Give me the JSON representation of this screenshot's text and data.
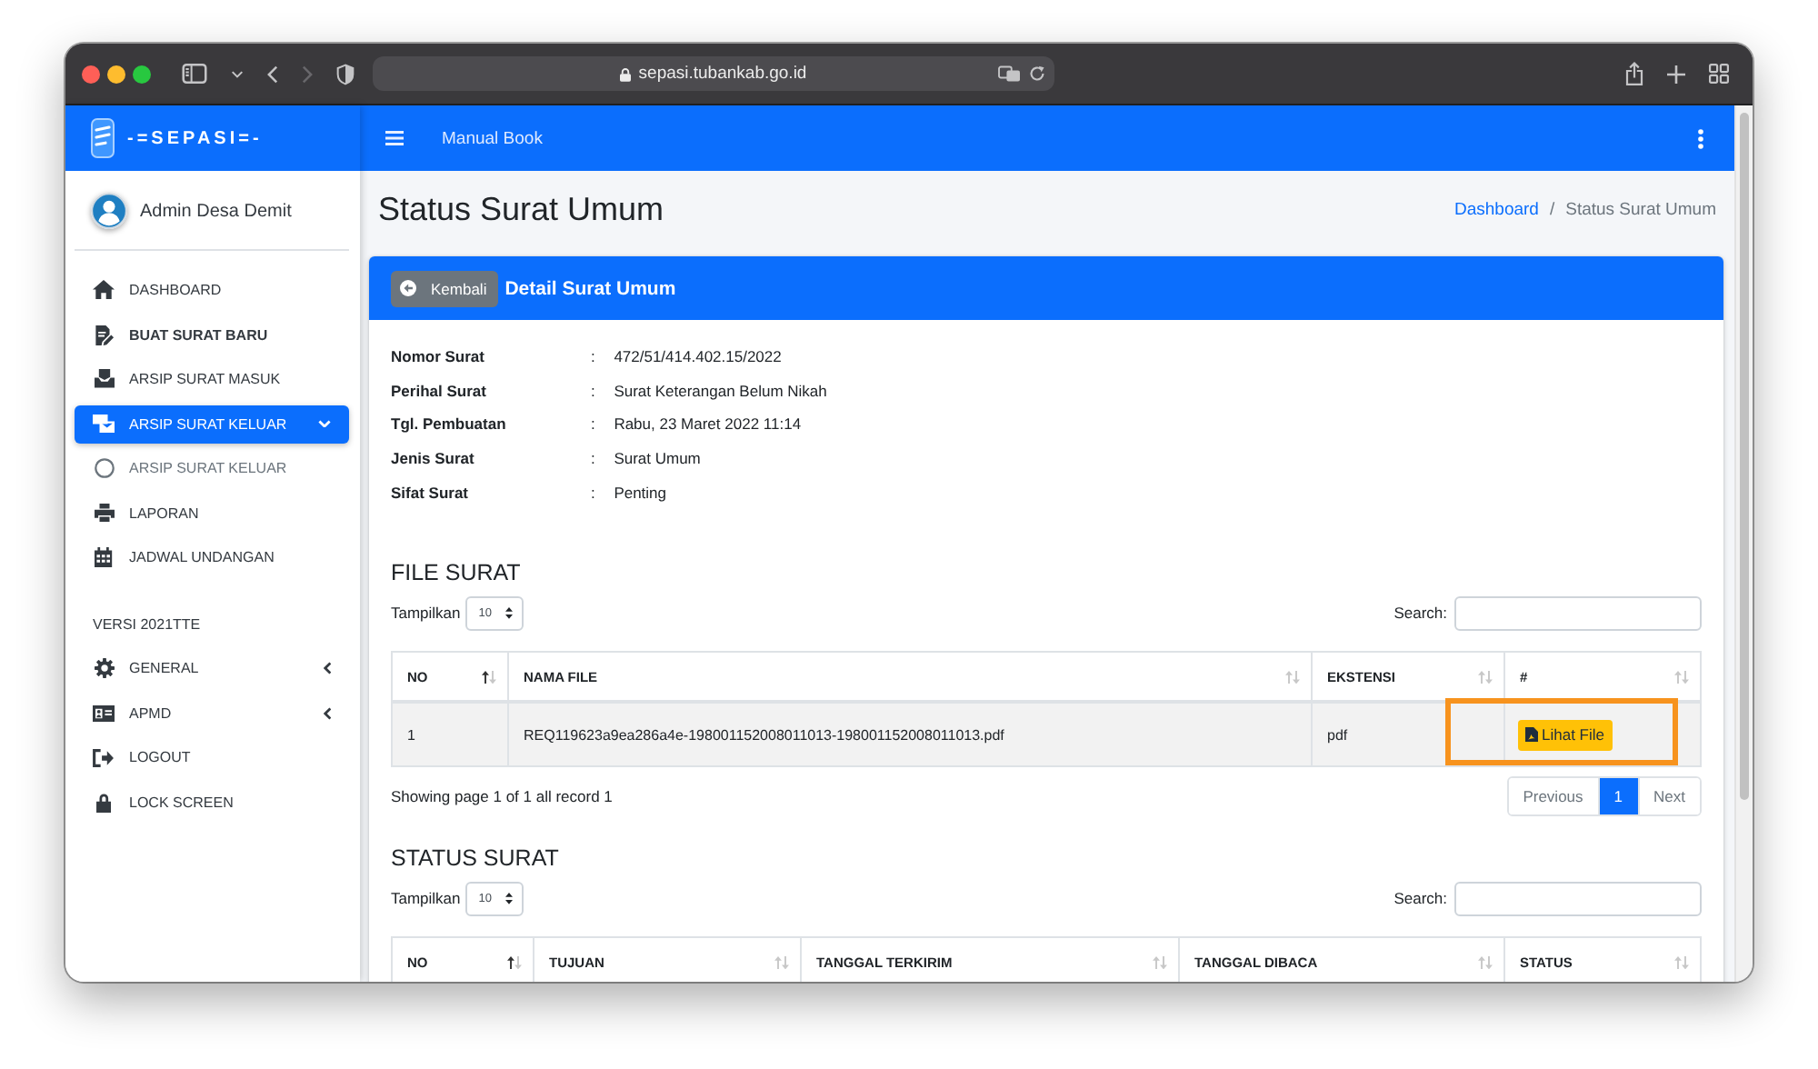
{
  "browser": {
    "nav": [
      {
        "kind": "back",
        "disabled": false
      },
      {
        "kind": "forward",
        "disabled": true
      }
    ],
    "url": "sepasi.tubankab.go.id"
  },
  "sidebar": {
    "logo": "-=SEPASI=-",
    "user": "Admin Desa Demit",
    "groups": [
      {
        "items": [
          {
            "label": "DASHBOARD",
            "bold": false,
            "selected": false
          },
          {
            "label": "BUAT SURAT BARU",
            "bold": true,
            "selected": false
          },
          {
            "label": "ARSIP SURAT MASUK",
            "bold": false,
            "selected": false
          },
          {
            "label": "ARSIP SURAT KELUAR",
            "bold": false,
            "selected": true,
            "expanded": true,
            "children": [
              {
                "label": "ARSIP SURAT KELUAR",
                "selected": false
              }
            ]
          },
          {
            "label": "LAPORAN",
            "bold": false,
            "selected": false
          },
          {
            "label": "JADWAL UNDANGAN",
            "bold": false,
            "selected": false
          }
        ]
      },
      {
        "header": "VERSI 2021TTE",
        "items": [
          {
            "label": "GENERAL",
            "bold": false,
            "selected": false,
            "expanded": false
          },
          {
            "label": "APMD",
            "bold": false,
            "selected": false,
            "expanded": false
          },
          {
            "label": "LOGOUT",
            "bold": false,
            "selected": false
          },
          {
            "label": "LOCK SCREEN",
            "bold": false,
            "selected": false
          }
        ]
      }
    ]
  },
  "topbar": {
    "link": "Manual Book"
  },
  "page": {
    "title": "Status Surat Umum",
    "breadcrumb": [
      {
        "kind": "link",
        "label": "Dashboard"
      },
      {
        "kind": "separator",
        "label": "/"
      },
      {
        "kind": "current",
        "label": "Status Surat Umum"
      }
    ]
  },
  "card": {
    "back_button": "Kembali",
    "title": "Detail Surat Umum",
    "details": [
      {
        "label": "Nomor Surat",
        "separator": ":",
        "value": "472/51/414.402.15/2022"
      },
      {
        "label": "Perihal Surat",
        "separator": ":",
        "value": "Surat Keterangan Belum Nikah"
      },
      {
        "label": "Tgl. Pembuatan",
        "separator": ":",
        "value": "Rabu, 23 Maret 2022 11:14"
      },
      {
        "label": "Jenis Surat",
        "separator": ":",
        "value": "Surat Umum"
      },
      {
        "label": "Sifat Surat",
        "separator": ":",
        "value": "Penting"
      }
    ],
    "tables": [
      {
        "title": "FILE SURAT",
        "length_label": "Tampilkan",
        "length_value": "10",
        "search_label": "Search:",
        "columns": [
          {
            "label": "NO",
            "sorted": true
          },
          {
            "label": "NAMA FILE",
            "sorted": false
          },
          {
            "label": "EKSTENSI",
            "sorted": false
          },
          {
            "label": "#",
            "sorted": false
          }
        ],
        "rows": [
          {
            "cells": [
              "1",
              "REQ119623a9ea286a4e-198001152008011013-198001152008011013.pdf",
              "pdf"
            ],
            "action": {
              "label": "Lihat File",
              "highlighted": true
            }
          }
        ],
        "info": "Showing page 1 of 1 all record 1",
        "pagination": [
          {
            "label": "Previous",
            "selected": false,
            "disabled": true
          },
          {
            "label": "1",
            "selected": true,
            "disabled": false
          },
          {
            "label": "Next",
            "selected": false,
            "disabled": true
          }
        ]
      },
      {
        "title": "STATUS SURAT",
        "length_label": "Tampilkan",
        "length_value": "10",
        "search_label": "Search:",
        "columns": [
          {
            "label": "NO",
            "sorted": true
          },
          {
            "label": "TUJUAN",
            "sorted": false
          },
          {
            "label": "TANGGAL TERKIRIM",
            "sorted": false
          },
          {
            "label": "TANGGAL DIBACA",
            "sorted": false
          },
          {
            "label": "STATUS",
            "sorted": false
          }
        ]
      }
    ]
  }
}
